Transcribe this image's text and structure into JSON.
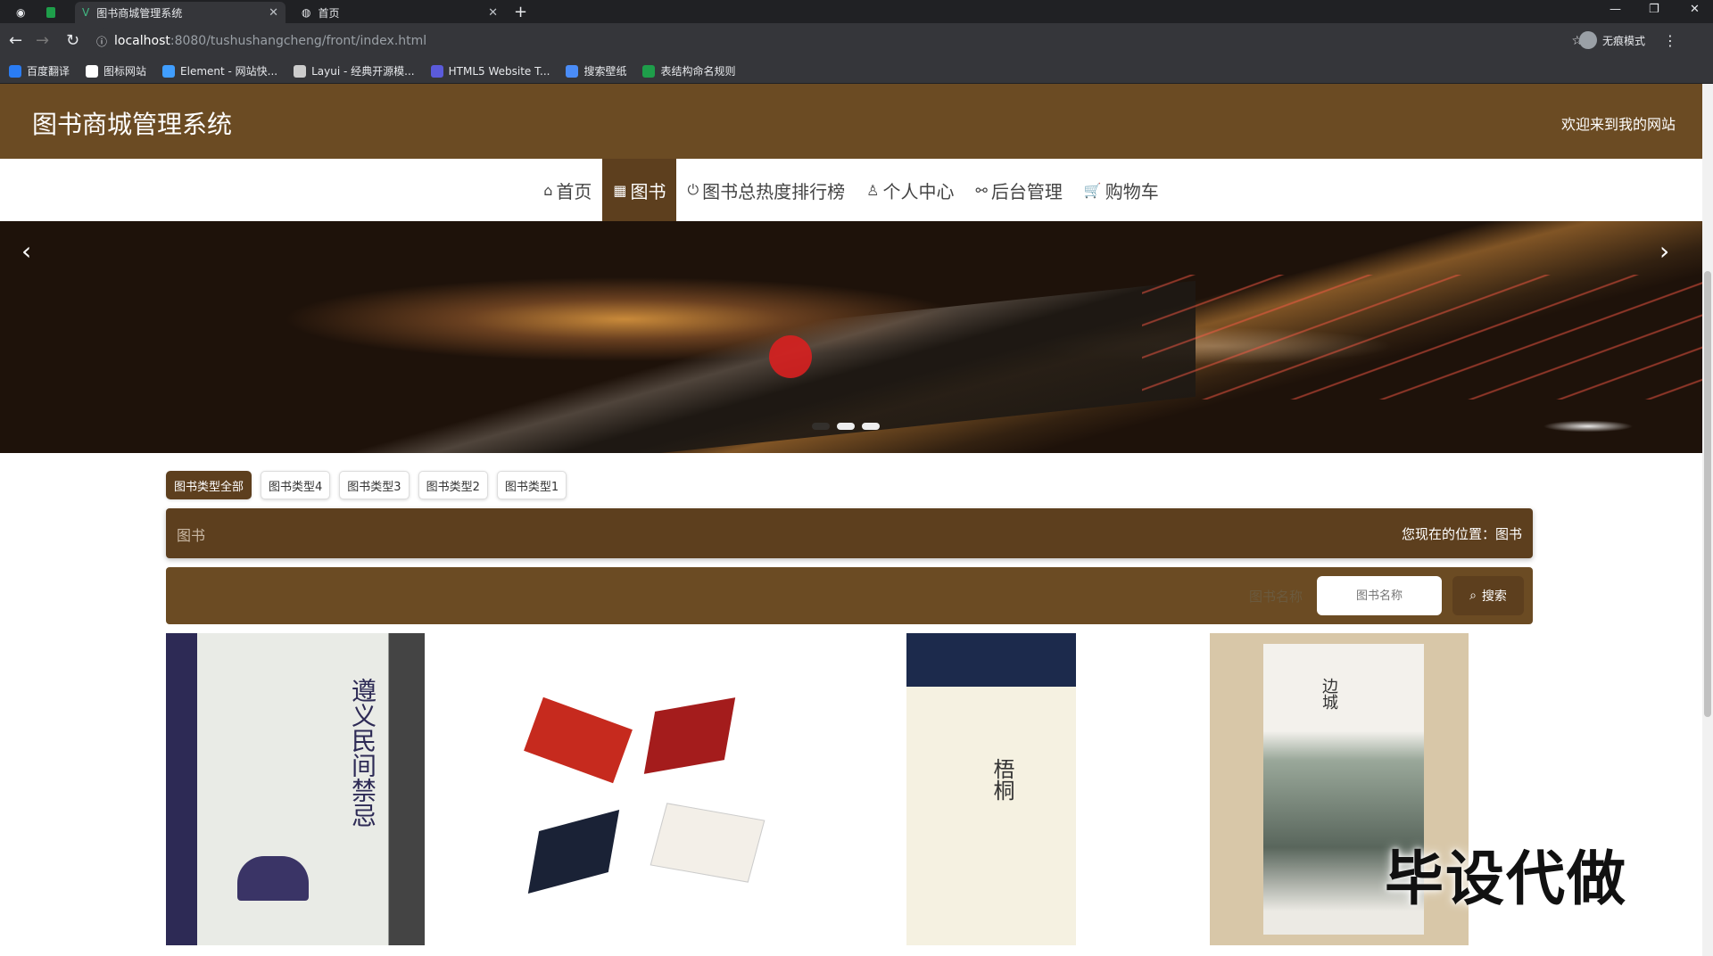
{
  "browser": {
    "tabs": [
      {
        "title": "图书商城管理系统",
        "active": true
      },
      {
        "title": "首页",
        "active": false
      }
    ],
    "url_host": "localhost",
    "url_path": ":8080/tushushangcheng/front/index.html",
    "profile_label": "无痕模式",
    "bookmarks": [
      {
        "label": "百度翻译",
        "icon": "translate-icon",
        "color": "#2a7cf3"
      },
      {
        "label": "图标网站",
        "icon": "flag-icon",
        "color": "#ffffff"
      },
      {
        "label": "Element - 网站快...",
        "icon": "element-icon",
        "color": "#409eff"
      },
      {
        "label": "Layui - 经典开源模...",
        "icon": "layui-icon",
        "color": "#cccccc"
      },
      {
        "label": "HTML5 Website T...",
        "icon": "html5-icon",
        "color": "#5b5bdb"
      },
      {
        "label": "搜索壁纸",
        "icon": "wallpaper-icon",
        "color": "#4a8cf7"
      },
      {
        "label": "表结构命名规则",
        "icon": "sheet-icon",
        "color": "#1e9e4a"
      }
    ]
  },
  "site": {
    "title": "图书商城管理系统",
    "welcome": "欢迎来到我的网站",
    "nav": [
      {
        "label": "首页",
        "icon": "home-icon",
        "active": false
      },
      {
        "label": "图书",
        "icon": "grid-icon",
        "active": true
      },
      {
        "label": "图书总热度排行榜",
        "icon": "power-icon",
        "active": false
      },
      {
        "label": "个人中心",
        "icon": "user-icon",
        "active": false
      },
      {
        "label": "后台管理",
        "icon": "link-icon",
        "active": false
      },
      {
        "label": "购物车",
        "icon": "cart-icon",
        "active": false
      }
    ],
    "accent": "#6b4b23"
  },
  "banner": {
    "prev_label": "‹",
    "next_label": "›"
  },
  "categories": [
    {
      "label": "图书类型全部",
      "active": true
    },
    {
      "label": "图书类型4",
      "active": false
    },
    {
      "label": "图书类型3",
      "active": false
    },
    {
      "label": "图书类型2",
      "active": false
    },
    {
      "label": "图书类型1",
      "active": false
    }
  ],
  "breadcrumb": {
    "section": "图书",
    "location": "您现在的位置：图书"
  },
  "search": {
    "label": "图书名称",
    "placeholder": "图书名称",
    "button": "搜索"
  },
  "books": [
    {
      "cover_text": "遵义民间禁忌"
    },
    {
      "cover_text": ""
    },
    {
      "cover_text": "梧桐"
    },
    {
      "cover_text": "边城"
    }
  ],
  "watermark": "毕设代做"
}
